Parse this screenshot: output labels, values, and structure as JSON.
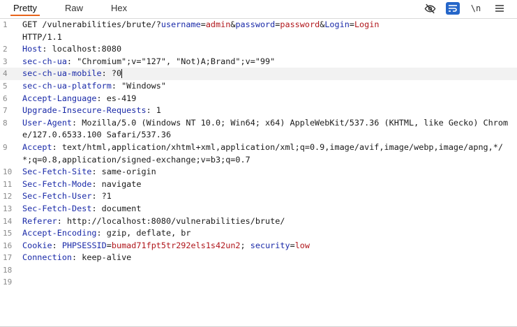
{
  "tabs": [
    {
      "label": "Pretty",
      "active": true
    },
    {
      "label": "Raw",
      "active": false
    },
    {
      "label": "Hex",
      "active": false
    }
  ],
  "toolbar": {
    "hide_nonprintable_icon": "eye-slash",
    "wrap_icon": "list-wrap",
    "newline_label": "\\n",
    "menu_icon": "hamburger"
  },
  "request": {
    "l1_method": "GET /vulnerabilities/brute/?",
    "l1_k1": "username",
    "l1_eq1": "=",
    "l1_v1": "admin",
    "l1_amp1": "&",
    "l1_k2": "password",
    "l1_eq2": "=",
    "l1_v2": "password",
    "l1_amp2": "&",
    "l1_k3": "Login",
    "l1_eq3": "=",
    "l1_v3": "Login",
    "l1_proto": "HTTP/1.1",
    "headers": [
      {
        "n": "2",
        "key": "Host",
        "val": "localhost:8080"
      },
      {
        "n": "3",
        "key": "sec-ch-ua",
        "val": "\"Chromium\";v=\"127\", \"Not)A;Brand\";v=\"99\""
      },
      {
        "n": "4",
        "key": "sec-ch-ua-mobile",
        "val": "?0"
      },
      {
        "n": "5",
        "key": "sec-ch-ua-platform",
        "val": "\"Windows\""
      },
      {
        "n": "6",
        "key": "Accept-Language",
        "val": "es-419"
      },
      {
        "n": "7",
        "key": "Upgrade-Insecure-Requests",
        "val": "1"
      },
      {
        "n": "8",
        "key": "User-Agent",
        "val": "Mozilla/5.0 (Windows NT 10.0; Win64; x64) AppleWebKit/537.36 (KHTML, like Gecko) Chrome/127.0.6533.100 Safari/537.36"
      },
      {
        "n": "9",
        "key": "Accept",
        "val": "text/html,application/xhtml+xml,application/xml;q=0.9,image/avif,image/webp,image/apng,*/*;q=0.8,application/signed-exchange;v=b3;q=0.7"
      },
      {
        "n": "10",
        "key": "Sec-Fetch-Site",
        "val": "same-origin"
      },
      {
        "n": "11",
        "key": "Sec-Fetch-Mode",
        "val": "navigate"
      },
      {
        "n": "12",
        "key": "Sec-Fetch-User",
        "val": "?1"
      },
      {
        "n": "13",
        "key": "Sec-Fetch-Dest",
        "val": "document"
      },
      {
        "n": "14",
        "key": "Referer",
        "val": "http://localhost:8080/vulnerabilities/brute/"
      },
      {
        "n": "15",
        "key": "Accept-Encoding",
        "val": "gzip, deflate, br"
      }
    ],
    "cookie": {
      "n": "16",
      "key": "Cookie",
      "c1k": "PHPSESSID",
      "c1v": "bumad71fpt5tr292els1s42un2",
      "sep": "; ",
      "c2k": "security",
      "c2v": "low"
    },
    "connection": {
      "n": "17",
      "key": "Connection",
      "val": "keep-alive"
    },
    "empty_lines": [
      "18",
      "19"
    ]
  },
  "colors": {
    "accent": "#e8641b",
    "header_key": "#1a2aa8",
    "param_value": "#b0161b",
    "toggle_blue": "#2566c9"
  }
}
